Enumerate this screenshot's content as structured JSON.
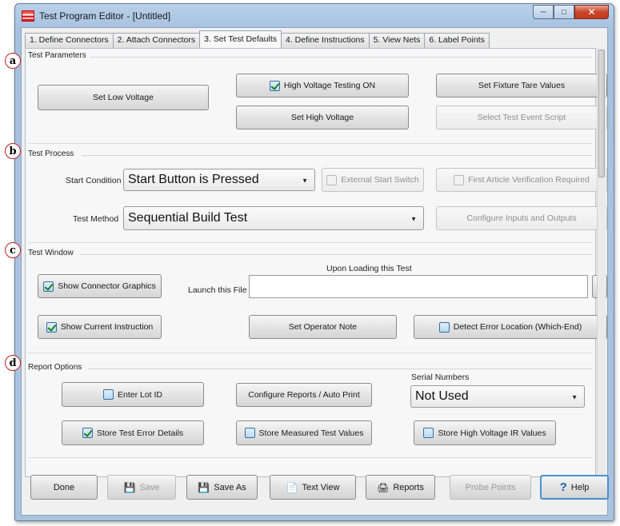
{
  "window": {
    "title": "Test Program Editor - [Untitled]"
  },
  "tabs": [
    "1. Define Connectors",
    "2. Attach Connectors",
    "3. Set Test Defaults",
    "4. Define Instructions",
    "5. View Nets",
    "6. Label Points"
  ],
  "markers": [
    "a",
    "b",
    "c",
    "d"
  ],
  "test_parameters": {
    "label": "Test Parameters",
    "set_low_voltage": "Set Low Voltage",
    "high_voltage_testing": {
      "label": "High Voltage Testing ON",
      "checked": true
    },
    "set_high_voltage": "Set High Voltage",
    "set_fixture_tare": "Set Fixture Tare Values",
    "select_test_event_script": "Select Test Event Script"
  },
  "test_process": {
    "label": "Test Process",
    "start_condition_label": "Start Condition",
    "start_condition_value": "Start Button is Pressed",
    "external_start_switch": {
      "label": "External Start Switch",
      "checked": false
    },
    "first_article_verification": {
      "label": "First Article Verification Required",
      "checked": false
    },
    "test_method_label": "Test Method",
    "test_method_value": "Sequential Build Test",
    "configure_io": "Configure Inputs and Outputs"
  },
  "test_window": {
    "label": "Test Window",
    "show_connector_graphics": {
      "label": "Show Connector Graphics",
      "checked": true
    },
    "upon_loading": "Upon Loading this Test",
    "launch_file_label": "Launch this File",
    "launch_file_value": "",
    "show_current_instruction": {
      "label": "Show Current Instruction",
      "checked": true
    },
    "set_operator_note": "Set Operator Note",
    "detect_error_location": {
      "label": "Detect Error Location (Which-End)",
      "checked": false
    }
  },
  "report_options": {
    "label": "Report Options",
    "enter_lot_id": {
      "label": "Enter Lot ID",
      "checked": false
    },
    "configure_reports": "Configure Reports / Auto Print",
    "serial_numbers_label": "Serial Numbers",
    "serial_numbers_value": "Not Used",
    "store_test_error_details": {
      "label": "Store Test Error Details",
      "checked": true
    },
    "store_measured_test_values": {
      "label": "Store Measured Test Values",
      "checked": false
    },
    "store_hv_ir_values": {
      "label": "Store High Voltage IR Values",
      "checked": false
    }
  },
  "footer": {
    "done": "Done",
    "save": "Save",
    "save_as": "Save As",
    "text_view": "Text View",
    "reports": "Reports",
    "probe_points": "Probe Points",
    "help": "Help"
  }
}
